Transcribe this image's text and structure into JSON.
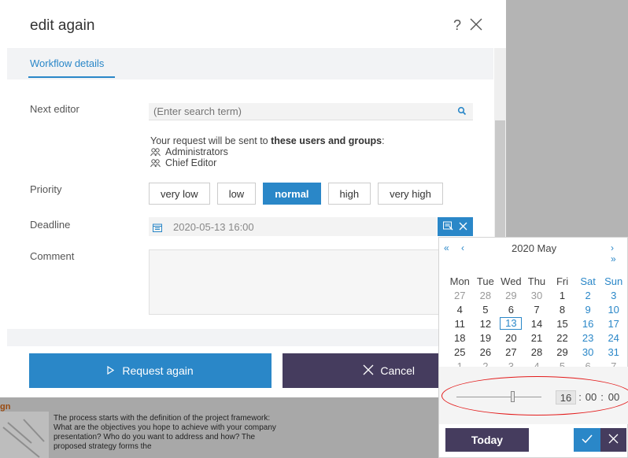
{
  "dialog": {
    "title": "edit again",
    "help": "?",
    "tab": "Workflow details"
  },
  "form": {
    "next_editor_label": "Next editor",
    "search_placeholder": "(Enter search term)",
    "recipients_prefix": "Your request will be sent to ",
    "recipients_bold": "these users and groups",
    "recipients_suffix": ":",
    "recipients": [
      "Administrators",
      "Chief Editor"
    ],
    "priority_label": "Priority",
    "priorities": [
      "very low",
      "low",
      "normal",
      "high",
      "very high"
    ],
    "priority_selected": "normal",
    "deadline_label": "Deadline",
    "deadline_value": "2020-05-13 16:00",
    "comment_label": "Comment"
  },
  "actions": {
    "request": "Request again",
    "cancel": "Cancel"
  },
  "background": {
    "heading": "gn",
    "text": "The process starts with the definition of the project framework: What are the objectives you hope to achieve with your company presentation? Who do you want to address and how? The proposed strategy forms the"
  },
  "datepicker": {
    "prev": "« ‹",
    "month": "2020 May",
    "next": "› »",
    "weekdays": [
      "Mon",
      "Tue",
      "Wed",
      "Thu",
      "Fri",
      "Sat",
      "Sun"
    ],
    "weeks": [
      [
        "27",
        "28",
        "29",
        "30",
        "1",
        "2",
        "3"
      ],
      [
        "4",
        "5",
        "6",
        "7",
        "8",
        "9",
        "10"
      ],
      [
        "11",
        "12",
        "13",
        "14",
        "15",
        "16",
        "17"
      ],
      [
        "18",
        "19",
        "20",
        "21",
        "22",
        "23",
        "24"
      ],
      [
        "25",
        "26",
        "27",
        "28",
        "29",
        "30",
        "31"
      ],
      [
        "1",
        "2",
        "3",
        "4",
        "5",
        "6",
        "7"
      ]
    ],
    "selected_day": "13",
    "time": {
      "hours": "16",
      "minutes": "00",
      "seconds": "00",
      "sep": ":"
    },
    "slider_fraction": 0.67,
    "today": "Today"
  },
  "colors": {
    "accent": "#2a87c8",
    "dark": "#453c5e",
    "highlight": "#e31b1b"
  }
}
